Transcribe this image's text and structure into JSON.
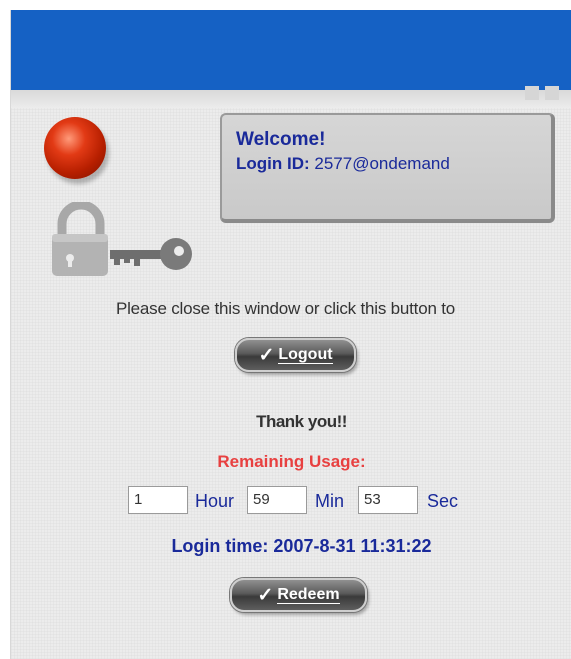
{
  "welcome": {
    "title": "Welcome!",
    "login_id_label": "Login ID:",
    "login_id_value": "2577@ondemand"
  },
  "prompt": "Please close this window or click this button to",
  "logout_button": {
    "label": "Logout"
  },
  "thank_you": "Thank you!!",
  "remaining": {
    "label": "Remaining Usage:",
    "hours": "1",
    "hour_unit": "Hour",
    "minutes": "59",
    "min_unit": "Min",
    "seconds": "53",
    "sec_unit": "Sec"
  },
  "login_time": "Login time: 2007-8-31 11:31:22",
  "redeem_button": {
    "label": "Redeem"
  },
  "colors": {
    "header": "#1561c4",
    "accent_text": "#1a2a9a",
    "remaining_label": "#e84040"
  },
  "icons": [
    "status-ball-icon",
    "lock-icon",
    "key-icon",
    "checkmark-icon"
  ]
}
